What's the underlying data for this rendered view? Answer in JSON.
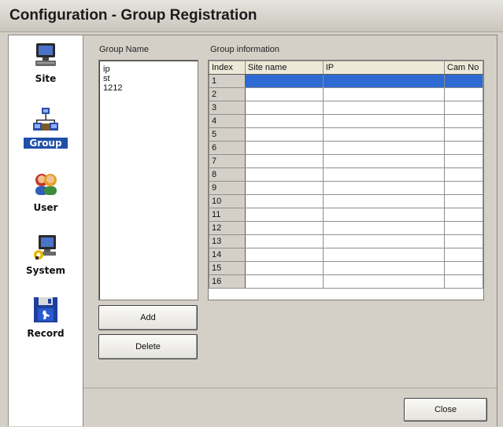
{
  "window": {
    "title": "Configuration - Group Registration"
  },
  "sidebar": {
    "items": [
      {
        "label": "Site",
        "icon": "computer-icon"
      },
      {
        "label": "Group",
        "icon": "network-icon"
      },
      {
        "label": "User",
        "icon": "users-icon"
      },
      {
        "label": "System",
        "icon": "system-settings-icon"
      },
      {
        "label": "Record",
        "icon": "floppy-disk-icon"
      }
    ],
    "selected": "Group"
  },
  "group_name": {
    "label": "Group Name",
    "items": [
      "ip",
      "st",
      "1212"
    ]
  },
  "group_info": {
    "label": "Group information",
    "columns": [
      "Index",
      "Site name",
      "IP",
      "Cam No"
    ],
    "rows": [
      "1",
      "2",
      "3",
      "4",
      "5",
      "6",
      "7",
      "8",
      "9",
      "10",
      "11",
      "12",
      "13",
      "14",
      "15",
      "16"
    ],
    "selected_row": "1"
  },
  "buttons": {
    "add": "Add",
    "delete": "Delete",
    "close": "Close"
  },
  "colors": {
    "selection": "#2d6bd3",
    "nav_selected": "#1f4fa8"
  }
}
